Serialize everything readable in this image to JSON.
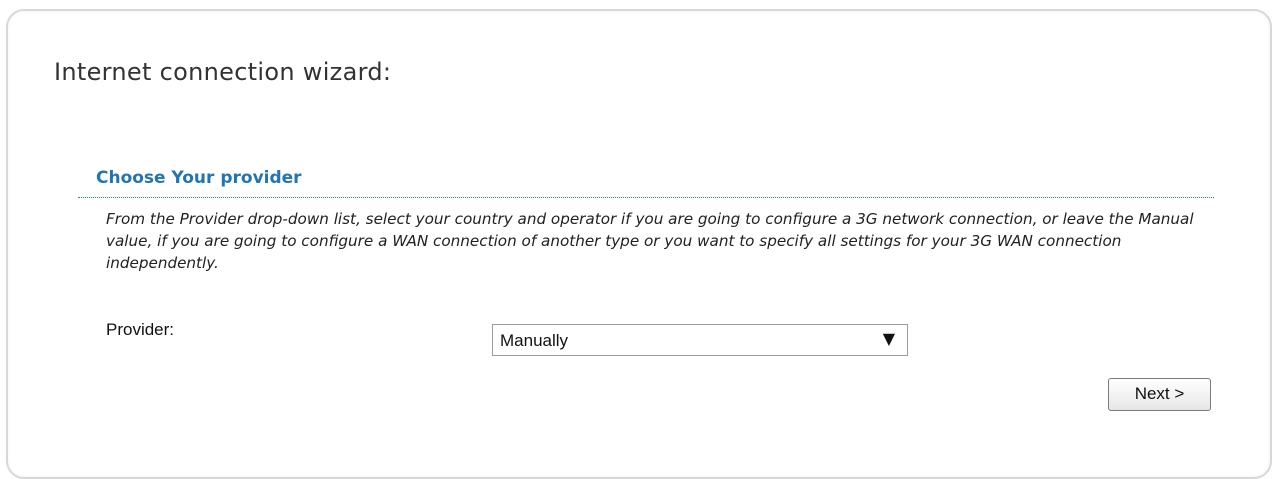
{
  "wizard": {
    "title": "Internet connection wizard:"
  },
  "section": {
    "title": "Choose Your provider",
    "description": "From the Provider drop-down list, select your country and operator if you are going to configure a 3G network connection, or leave the Manual value, if you are going to configure a WAN connection of another type or you want to specify all settings for your 3G WAN connection independently."
  },
  "provider": {
    "label": "Provider:",
    "selected": "Manually",
    "arrow_glyph": "▼"
  },
  "buttons": {
    "next_label": "Next >"
  },
  "colors": {
    "section_title": "#2175b3",
    "panel_border": "#d8d8d8"
  }
}
